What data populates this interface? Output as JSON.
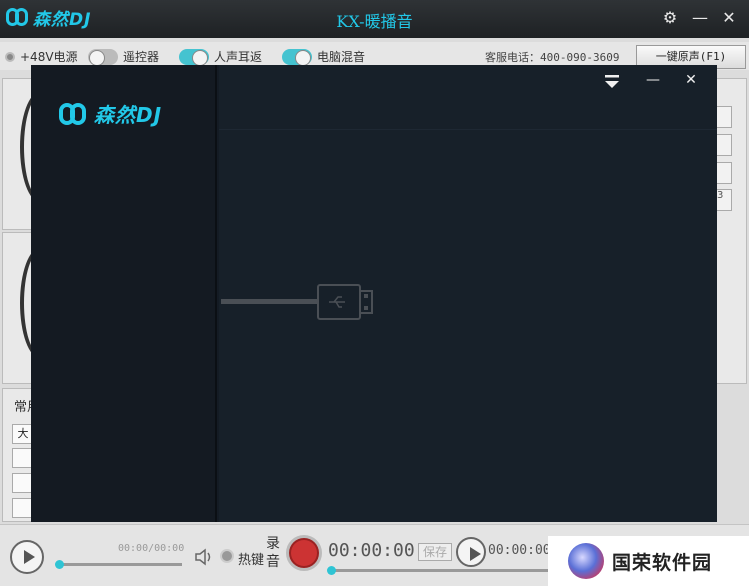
{
  "app": {
    "brand": "森然DJ",
    "title": "KX-暖播音",
    "settings_icon": "gear-icon",
    "minimize_icon": "minimize-icon",
    "close_icon": "close-icon"
  },
  "options": {
    "phantom_power": "+48V电源",
    "remote": "遥控器",
    "monitor": "人声耳返",
    "pc_mix": "电脑混音",
    "hotline": "客服电话：400-090-3609",
    "original_voice_button": "一键原声(F1)"
  },
  "background": {
    "section_label": "常用",
    "side_button_label": "3",
    "small_buttons": [
      "大",
      "",
      "",
      ""
    ]
  },
  "bottombar": {
    "player_time": "00:00/00:00",
    "hotkey_label": "热键",
    "record_label": "录音",
    "record_time": "00:00:00",
    "save_label": "保存",
    "playback_time": "00:00:00",
    "accent_color": "#2fc4d4"
  },
  "dialog": {
    "brand": "森然DJ",
    "collapse_icon": "collapse-down-icon",
    "minimize_icon": "minimize-icon",
    "close_icon": "close-icon",
    "status_icon": "usb-disconnected-icon",
    "accent_color": "#22c8e8"
  },
  "watermark": {
    "text": "国荣软件园"
  }
}
